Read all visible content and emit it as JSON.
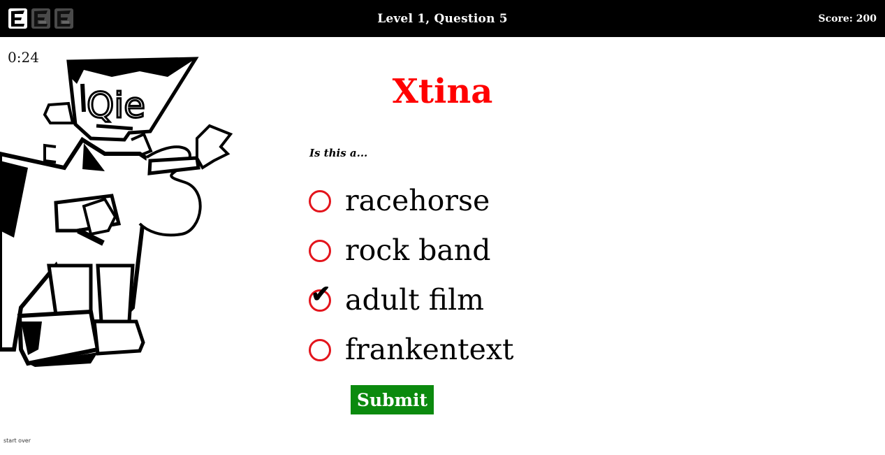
{
  "header": {
    "title": "Level 1, Question 5",
    "score": "Score: 200",
    "lives": [
      "life-icon",
      "life-icon",
      "life-icon"
    ]
  },
  "timer": "0:24",
  "question": {
    "word": "Xtina",
    "prompt": "Is this a...",
    "options": [
      {
        "label": "racehorse",
        "checked": false
      },
      {
        "label": "rock band",
        "checked": false
      },
      {
        "label": "adult film",
        "checked": true
      },
      {
        "label": "frankentext",
        "checked": false
      }
    ],
    "check_glyph": "✔"
  },
  "submit_label": "Submit",
  "start_over_label": "start over",
  "mascot_text": "Qie",
  "colors": {
    "header_bg": "#000000",
    "word": "#ff0000",
    "radio": "#e3141c",
    "submit_bg": "#0b8a0e"
  }
}
